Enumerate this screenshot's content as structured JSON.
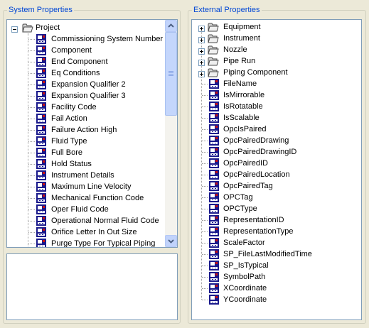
{
  "system_properties": {
    "title": "System Properties",
    "root_label": "Project",
    "items": [
      "Commissioning System Number",
      "Component",
      "End Component",
      "Eq Conditions",
      "Expansion Qualifier 2",
      "Expansion Qualifier 3",
      "Facility Code",
      "Fail Action",
      "Failure Action High",
      "Fluid Type",
      "Full Bore",
      "Hold Status",
      "Instrument Details",
      "Maximum Line Velocity",
      "Mechanical Function Code",
      "Oper Fluid Code",
      "Operational Normal Fluid Code",
      "Orifice Letter In Out Size",
      "Purge Type For Typical Piping"
    ],
    "description": ""
  },
  "external_properties": {
    "title": "External Properties",
    "folders": [
      "Equipment",
      "Instrument",
      "Nozzle",
      "Pipe Run",
      "Piping Component"
    ],
    "items": [
      "FileName",
      "IsMirrorable",
      "IsRotatable",
      "IsScalable",
      "OpcIsPaired",
      "OpcPairedDrawing",
      "OpcPairedDrawingID",
      "OpcPairedID",
      "OpcPairedLocation",
      "OpcPairedTag",
      "OPCTag",
      "OPCType",
      "RepresentationID",
      "RepresentationType",
      "ScaleFactor",
      "SP_FileLastModifiedTime",
      "SP_IsTypical",
      "SymbolPath",
      "XCoordinate",
      "YCoordinate"
    ]
  },
  "icons": {
    "folder": "folder-icon",
    "property": "property-icon",
    "expand": "plus-box-icon",
    "collapse": "minus-box-icon"
  },
  "colors": {
    "title_text": "#0046d5",
    "window_bg": "#ece9d8",
    "tree_border": "#7f9db9",
    "property_icon": "#1a1a8c",
    "property_icon_accent": "#cc1111"
  }
}
